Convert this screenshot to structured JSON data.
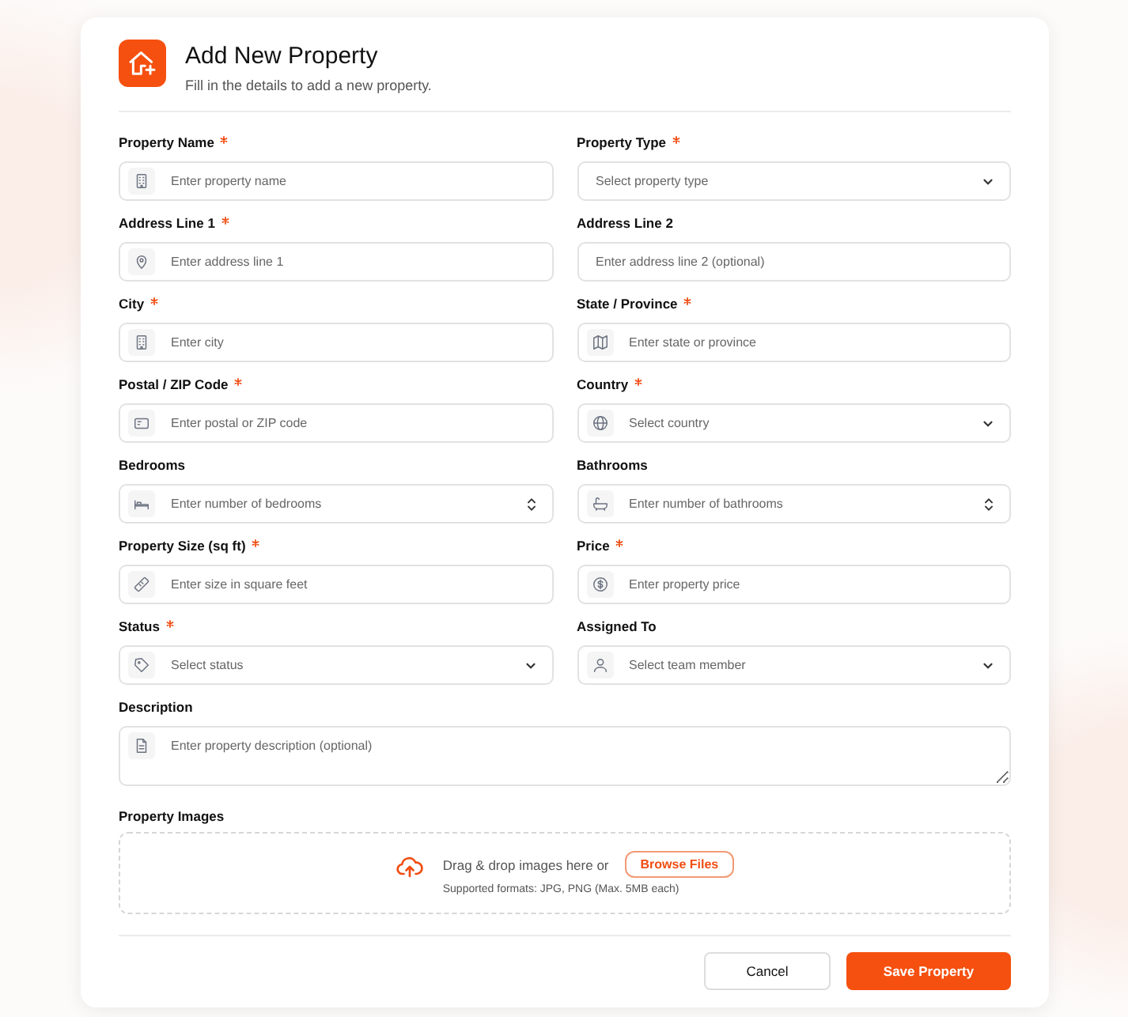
{
  "header": {
    "title": "Add New Property",
    "subtitle": "Fill in the details to add a new property."
  },
  "fields": [
    {
      "label": "Property Name",
      "required": true,
      "kind": "text",
      "placeholder": "Enter property name"
    },
    {
      "label": "Property Type",
      "required": true,
      "kind": "select",
      "placeholder": "Select property type"
    },
    {
      "label": "Address Line 1",
      "required": true,
      "kind": "text",
      "placeholder": "Enter address line 1"
    },
    {
      "label": "Address Line 2",
      "required": false,
      "kind": "text",
      "placeholder": "Enter address line 2 (optional)"
    },
    {
      "label": "City",
      "required": true,
      "kind": "text",
      "placeholder": "Enter city"
    },
    {
      "label": "State / Province",
      "required": true,
      "kind": "text",
      "placeholder": "Enter state or province"
    },
    {
      "label": "Postal / ZIP Code",
      "required": true,
      "kind": "text",
      "placeholder": "Enter postal or ZIP code"
    },
    {
      "label": "Country",
      "required": true,
      "kind": "select",
      "placeholder": "Select country"
    },
    {
      "label": "Bedrooms",
      "required": false,
      "kind": "number",
      "placeholder": "Enter number of bedrooms"
    },
    {
      "label": "Bathrooms",
      "required": false,
      "kind": "number",
      "placeholder": "Enter number of bathrooms"
    },
    {
      "label": "Property Size (sq ft)",
      "required": true,
      "kind": "text",
      "placeholder": "Enter size in square feet"
    },
    {
      "label": "Price",
      "required": true,
      "kind": "text",
      "placeholder": "Enter property price"
    },
    {
      "label": "Status",
      "required": true,
      "kind": "select",
      "placeholder": "Select status"
    },
    {
      "label": "Assigned To",
      "required": false,
      "kind": "select",
      "placeholder": "Select team member"
    },
    {
      "label": "Description",
      "required": false,
      "kind": "textarea",
      "placeholder": "Enter property description (optional)"
    }
  ],
  "upload": {
    "label": "Property Images",
    "prompt": "Drag & drop images here or",
    "browse": "Browse Files",
    "hint": "Supported formats: JPG, PNG (Max. 5MB each)"
  },
  "actions": {
    "cancel": "Cancel",
    "save": "Save Property"
  }
}
